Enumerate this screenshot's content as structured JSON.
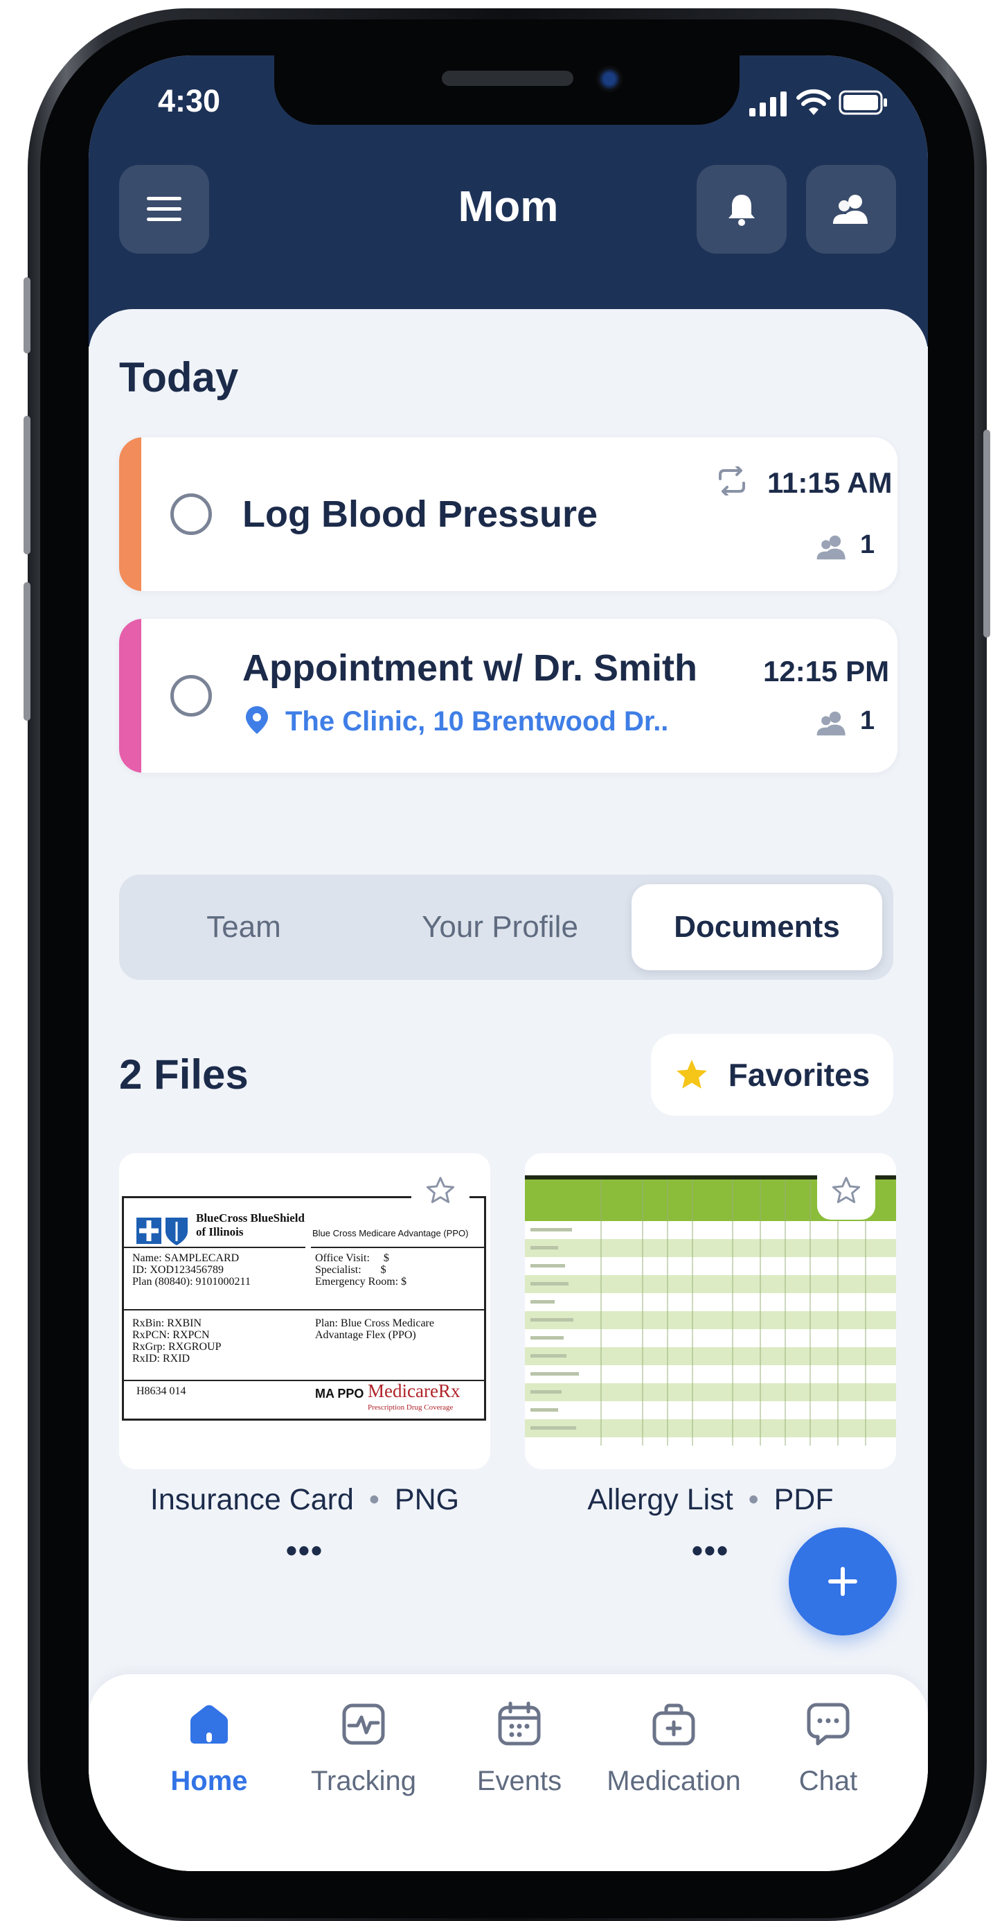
{
  "status_bar": {
    "time": "4:30"
  },
  "header": {
    "title": "Mom"
  },
  "today": {
    "heading": "Today",
    "tasks": [
      {
        "title": "Log Blood Pressure",
        "time": "11:15 AM",
        "assignees": "1",
        "color": "#f28c5a",
        "recurring": true
      },
      {
        "title": "Appointment w/ Dr. Smith",
        "time": "12:15 PM",
        "assignees": "1",
        "location": "The Clinic, 10 Brentwood Dr..",
        "color": "#e55fab"
      }
    ]
  },
  "tabs": {
    "items": [
      "Team",
      "Your Profile",
      "Documents"
    ],
    "active": "Documents"
  },
  "files": {
    "count_label": "2 Files",
    "favorites_label": "Favorites",
    "items": [
      {
        "name": "Insurance Card",
        "type": "PNG",
        "separator": "•",
        "more": "•••",
        "preview": {
          "brand": "BlueCross BlueShield",
          "brand_sub": "of Illinois",
          "plan_name": "Blue Cross Medicare Advantage (PPO)",
          "member_lines": "Name: SAMPLECARD\nID: XOD123456789\nPlan (80840): 9101000211",
          "copay_lines": "Office Visit:     $\nSpecialist:       $\nEmergency Room: $",
          "rx_lines": "RxBin: RXBIN\nRxPCN: RXPCN\nRxGrp: RXGROUP\nRxID: RXID",
          "plan_lines": "Plan: Blue Cross Medicare\nAdvantage Flex (PPO)",
          "contract": "H8634 014",
          "ma_label": "MA PPO",
          "medicare_label": "MedicareRx",
          "medicare_sub": "Prescription Drug Coverage"
        }
      },
      {
        "name": "Allergy List",
        "type": "PDF",
        "separator": "•",
        "more": "•••"
      }
    ]
  },
  "nav": {
    "items": [
      {
        "label": "Home",
        "icon": "home-icon",
        "active": true
      },
      {
        "label": "Tracking",
        "icon": "tracking-icon",
        "active": false
      },
      {
        "label": "Events",
        "icon": "calendar-icon",
        "active": false
      },
      {
        "label": "Medication",
        "icon": "medkit-icon",
        "active": false
      },
      {
        "label": "Chat",
        "icon": "chat-icon",
        "active": false
      }
    ]
  },
  "colors": {
    "header": "#1d3257",
    "accent": "#3273e6",
    "background": "#f0f3f8",
    "text": "#1c2b4a",
    "favorite_star": "#f5c518"
  }
}
